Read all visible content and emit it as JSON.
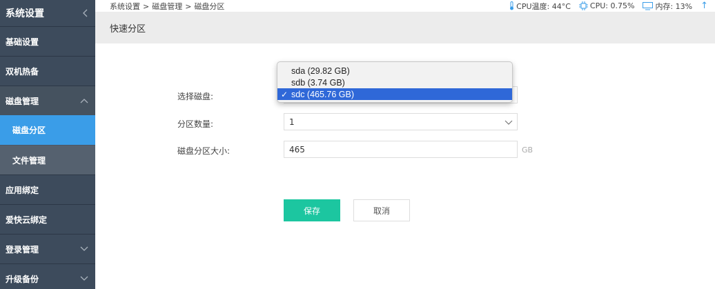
{
  "sidebar": {
    "title": "系统设置",
    "items": [
      {
        "label": "基础设置"
      },
      {
        "label": "双机热备"
      },
      {
        "label": "磁盘管理"
      },
      {
        "label": "磁盘分区"
      },
      {
        "label": "文件管理"
      },
      {
        "label": "应用绑定"
      },
      {
        "label": "爱快云绑定"
      },
      {
        "label": "登录管理"
      },
      {
        "label": "升级备份"
      }
    ]
  },
  "breadcrumb": {
    "path": [
      "系统设置",
      ">",
      "磁盘管理",
      ">",
      "磁盘分区"
    ]
  },
  "stats": {
    "cpu_temp": "CPU温度: 44°C",
    "cpu": "CPU: 0.75%",
    "memory": "内存: 13%",
    "up_arrow": "↑"
  },
  "section": {
    "title": "快速分区"
  },
  "form": {
    "disk_label": "选择磁盘:",
    "count_label": "分区数量:",
    "count_value": "1",
    "size_label": "磁盘分区大小:",
    "size_value": "465",
    "size_unit": "GB"
  },
  "dropdown": {
    "options": [
      "sda (29.82 GB)",
      "sdb (3.74 GB)",
      "sdc (465.76 GB)"
    ],
    "selected_index": 2,
    "check": "✓"
  },
  "buttons": {
    "save": "保存",
    "cancel": "取消"
  },
  "colors": {
    "sidebar_bg": "#3d4b5c",
    "active": "#3a9de8",
    "save_button": "#1cc6a0",
    "dropdown_selected": "#2f68d8"
  }
}
